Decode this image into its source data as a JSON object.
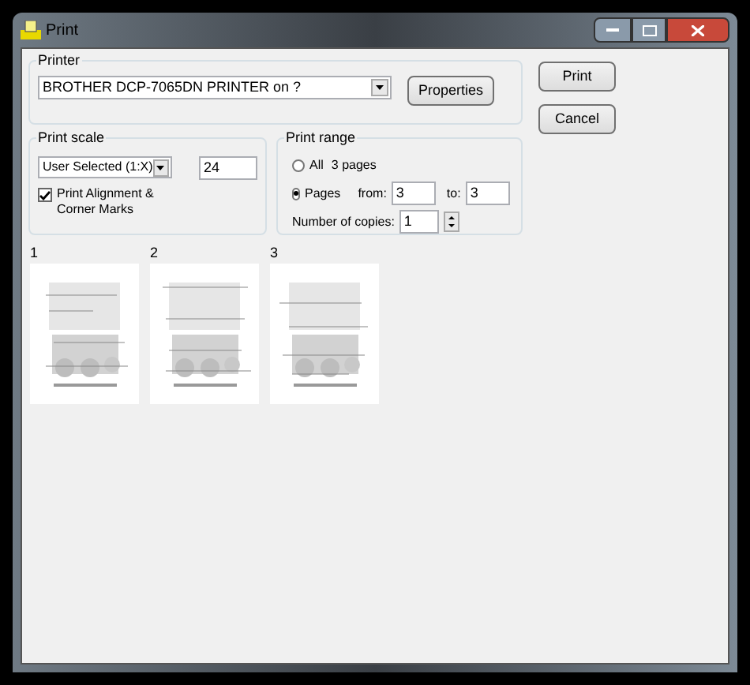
{
  "window": {
    "title": "Print"
  },
  "printer": {
    "label": "Printer",
    "selected_printer": "BROTHER DCP-7065DN PRINTER on ?",
    "properties_button": "Properties"
  },
  "buttons": [
    "Print",
    "Cancel"
  ],
  "print_scale": {
    "label": "Print scale",
    "mode": "User Selected (1:X)",
    "value": "24",
    "alignment_marks": {
      "label": "Print Alignment & Corner Marks",
      "checked": true
    }
  },
  "print_range": {
    "label": "Print range",
    "options": [
      {
        "label": "All",
        "detail": "3 pages",
        "selected": false
      },
      {
        "label": "Pages",
        "selected": true
      }
    ],
    "from_label": "from:",
    "from": "3",
    "to_label": "to:",
    "to": "3",
    "copies_label": "Number of copies:",
    "copies": "1"
  },
  "pages": [
    {
      "number": "1",
      "kind": "picture"
    },
    {
      "number": "2",
      "kind": "picture"
    },
    {
      "number": "3",
      "kind": "picture"
    }
  ]
}
